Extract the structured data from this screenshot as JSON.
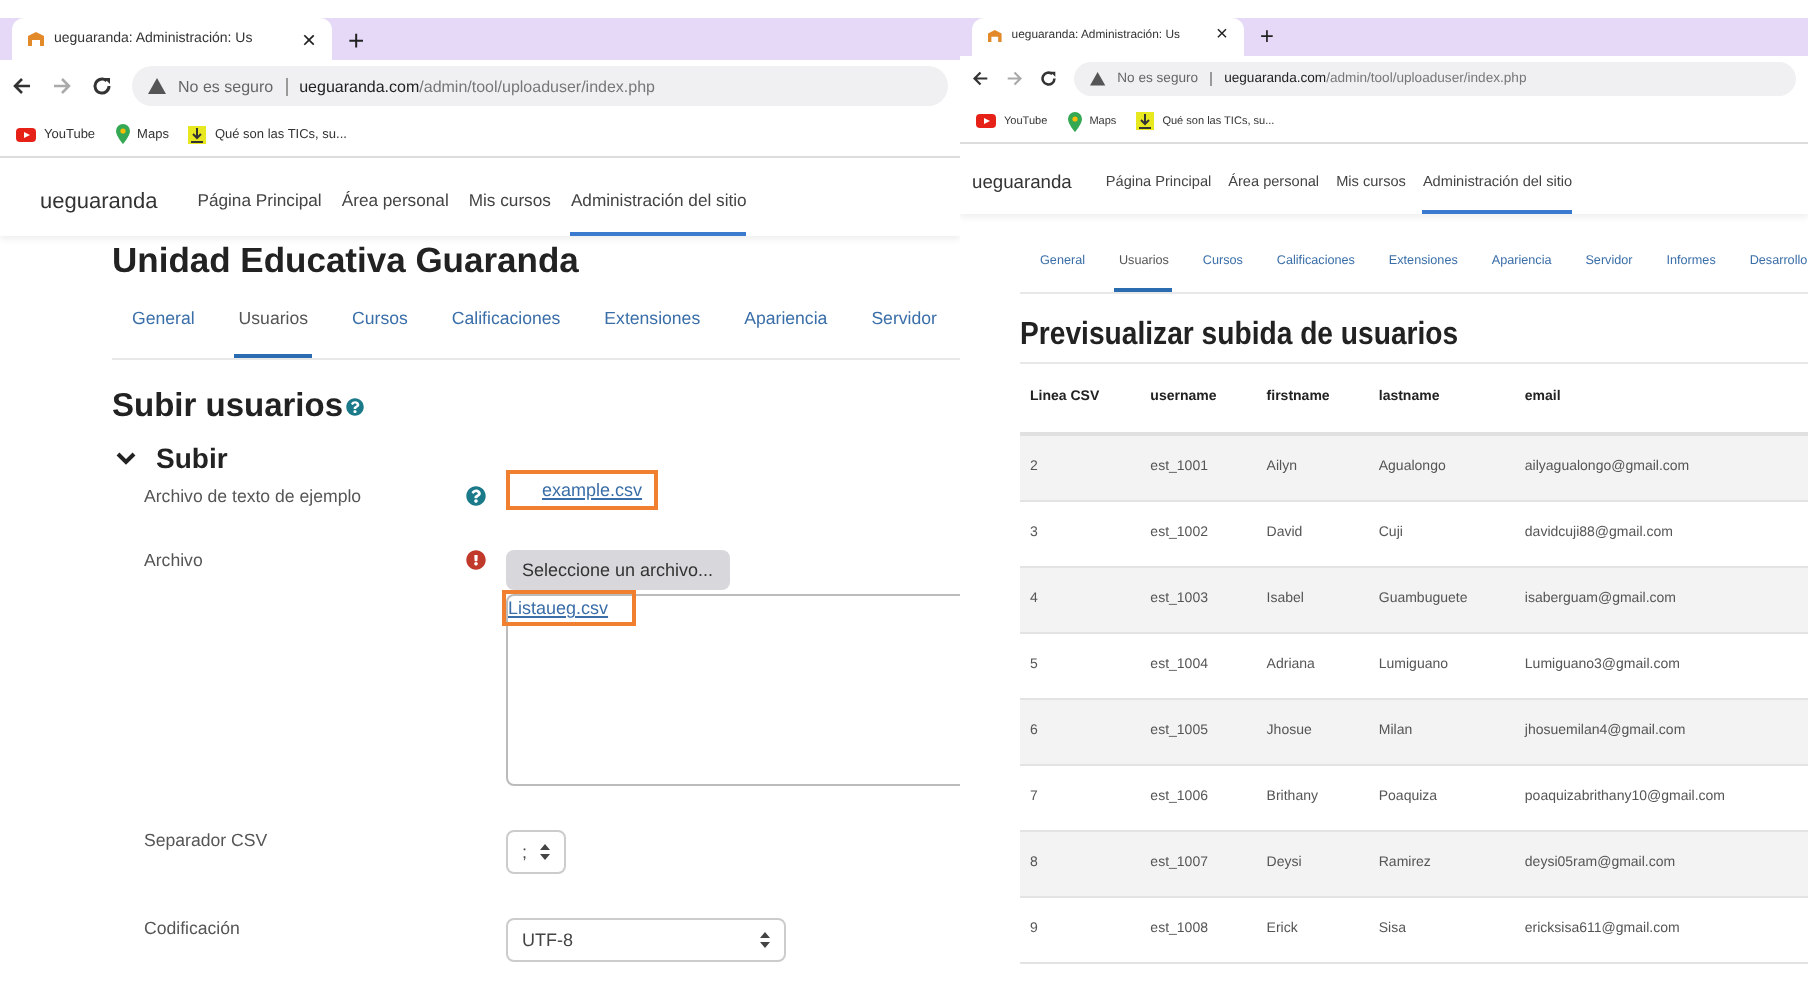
{
  "left": {
    "browser": {
      "tab_title": "ueguaranda: Administración: Us",
      "close": "×",
      "new_tab": "+",
      "security": "No es seguro",
      "url_host": "ueguaranda.com",
      "url_path": "/admin/tool/uploaduser/index.php",
      "bookmarks": [
        {
          "kind": "youtube",
          "label": "YouTube"
        },
        {
          "kind": "maps",
          "label": "Maps"
        },
        {
          "kind": "download",
          "label": "Qué son las TICs, su..."
        }
      ]
    },
    "navbar": {
      "brand": "ueguaranda",
      "items": [
        {
          "label": "Página Principal",
          "selected": false
        },
        {
          "label": "Área personal",
          "selected": false
        },
        {
          "label": "Mis cursos",
          "selected": false
        },
        {
          "label": "Administración del sitio",
          "selected": true
        }
      ]
    },
    "site_title": "Unidad Educativa Guaranda",
    "tabs": [
      {
        "label": "General",
        "selected": false
      },
      {
        "label": "Usuarios",
        "selected": true
      },
      {
        "label": "Cursos",
        "selected": false
      },
      {
        "label": "Calificaciones",
        "selected": false
      },
      {
        "label": "Extensiones",
        "selected": false
      },
      {
        "label": "Apariencia",
        "selected": false
      },
      {
        "label": "Servidor",
        "selected": false
      }
    ],
    "heading": "Subir usuarios",
    "section": {
      "title": "Subir",
      "expanded": true
    },
    "fields": [
      {
        "kind": "link",
        "label": "Archivo de texto de ejemplo",
        "value": "example.csv",
        "highlighted": true
      },
      {
        "kind": "file",
        "label": "Archivo",
        "button": "Seleccione un archivo...",
        "value": "Listaueg.csv",
        "highlighted": true
      },
      {
        "kind": "select",
        "label": "Separador CSV",
        "value": ";",
        "wide": false
      },
      {
        "kind": "select",
        "label": "Codificación",
        "value": "UTF-8",
        "wide": true
      }
    ]
  },
  "right": {
    "browser": {
      "tab_title": "ueguaranda: Administración: Us",
      "close": "×",
      "new_tab": "+",
      "security": "No es seguro",
      "url_host": "ueguaranda.com",
      "url_path": "/admin/tool/uploaduser/index.php",
      "bookmarks": [
        {
          "kind": "youtube",
          "label": "YouTube"
        },
        {
          "kind": "maps",
          "label": "Maps"
        },
        {
          "kind": "download",
          "label": "Qué son las TICs, su..."
        }
      ]
    },
    "navbar": {
      "brand": "ueguaranda",
      "items": [
        {
          "label": "Página Principal",
          "selected": false
        },
        {
          "label": "Área personal",
          "selected": false
        },
        {
          "label": "Mis cursos",
          "selected": false
        },
        {
          "label": "Administración del sitio",
          "selected": true
        }
      ]
    },
    "tabs": [
      {
        "label": "General",
        "selected": false
      },
      {
        "label": "Usuarios",
        "selected": true
      },
      {
        "label": "Cursos",
        "selected": false
      },
      {
        "label": "Calificaciones",
        "selected": false
      },
      {
        "label": "Extensiones",
        "selected": false
      },
      {
        "label": "Apariencia",
        "selected": false
      },
      {
        "label": "Servidor",
        "selected": false
      },
      {
        "label": "Informes",
        "selected": false
      },
      {
        "label": "Desarrollo",
        "selected": false
      }
    ],
    "heading": "Previsualizar subida de usuarios",
    "table": {
      "columns": [
        "Linea CSV",
        "username",
        "firstname",
        "lastname",
        "email"
      ],
      "rows": [
        [
          "2",
          "est_1001",
          "Ailyn",
          "Agualongo",
          "ailyagualongo@gmail.com"
        ],
        [
          "3",
          "est_1002",
          "David",
          "Cuji",
          "davidcuji88@gmail.com"
        ],
        [
          "4",
          "est_1003",
          "Isabel",
          "Guambuguete",
          "isaberguam@gmail.com"
        ],
        [
          "5",
          "est_1004",
          "Adriana",
          "Lumiguano",
          "Lumiguano3@gmail.com"
        ],
        [
          "6",
          "est_1005",
          "Jhosue",
          "Milan",
          "jhosuemilan4@gmail.com"
        ],
        [
          "7",
          "est_1006",
          "Brithany",
          "Poaquiza",
          "poaquizabrithany10@gmail.com"
        ],
        [
          "8",
          "est_1007",
          "Deysi",
          "Ramirez",
          "deysi05ram@gmail.com"
        ],
        [
          "9",
          "est_1008",
          "Erick",
          "Sisa",
          "ericksisa611@gmail.com"
        ]
      ]
    }
  }
}
